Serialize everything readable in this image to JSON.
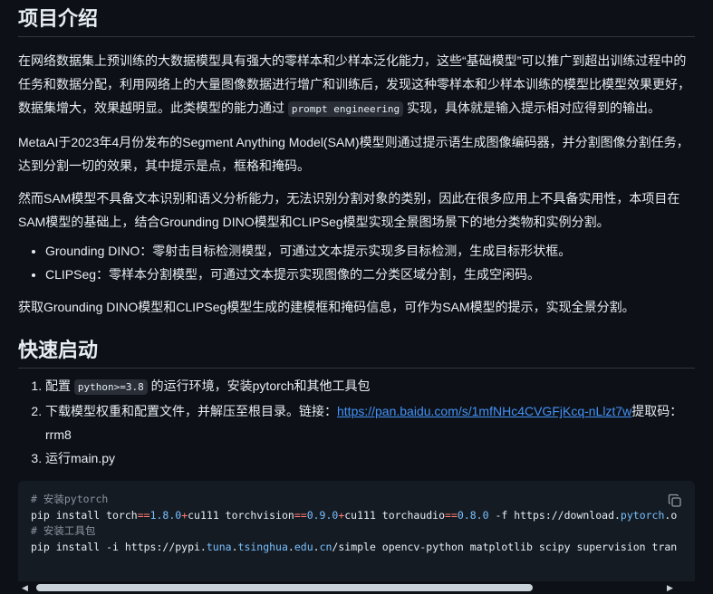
{
  "intro": {
    "heading": "项目介绍",
    "p1_a": "在网络数据集上预训练的大数据模型具有强大的零样本和少样本泛化能力，这些“基础模型”可以推广到超出训练过程中的任务和数据分配，利用网络上的大量图像数据进行增广和训练后，发现这种零样本和少样本训练的模型比模型效果更好，数据集增大，效果越明显。此类模型的能力通过",
    "p1_code": "prompt engineering",
    "p1_b": "实现，具体就是输入提示相对应得到的输出。",
    "p2": "MetaAI于2023年4月份发布的Segment Anything Model(SAM)模型则通过提示语生成图像编码器，并分割图像分割任务，达到分割一切的效果，其中提示是点，框格和掩码。",
    "p3": "然而SAM模型不具备文本识别和语义分析能力，无法识别分割对象的类别，因此在很多应用上不具备实用性，本项目在SAM模型的基础上，结合Grounding DINO模型和CLIPSeg模型实现全景图场景下的地分类物和实例分割。",
    "bullets": [
      "Grounding DINO：零射击目标检测模型，可通过文本提示实现多目标检测，生成目标形状框。",
      "CLIPSeg：零样本分割模型，可通过文本提示实现图像的二分类区域分割，生成空闲码。"
    ],
    "p4": "获取Grounding DINO模型和CLIPSeg模型生成的建模框和掩码信息，可作为SAM模型的提示，实现全景分割。"
  },
  "quick": {
    "heading": "快速启动",
    "step1_a": "配置",
    "step1_code": "python>=3.8",
    "step1_b": "的运行环境，安装pytorch和其他工具包",
    "step2_a": "下载模型权重和配置文件，并解压至根目录。链接：",
    "step2_link": "https://pan.baidu.com/s/1mfNHc4CVGFjKcq-nLlzt7w",
    "step2_b": "提取码：rrm8",
    "step3": "运行main.py"
  },
  "code": {
    "c1": "# 安装pytorch",
    "l2_a": "pip install torch",
    "l2_op1": "==",
    "l2_n1": "1.8.0",
    "l2_op2": "+",
    "l2_b": "cu111 torchvision",
    "l2_op3": "==",
    "l2_n2": "0.9.0",
    "l2_op4": "+",
    "l2_c": "cu111 torchaudio",
    "l2_op5": "==",
    "l2_n3": "0.8.0",
    "l2_d": " -f https://download.",
    "l2_n4": "pytorch",
    "l2_e": ".o",
    "c2": "# 安装工具包",
    "l4_a": "pip install -i https://pypi.",
    "l4_n1": "tuna",
    "l4_b": ".",
    "l4_n2": "tsinghua",
    "l4_c": ".",
    "l4_n3": "edu",
    "l4_d": ".",
    "l4_n4": "cn",
    "l4_e": "/simple opencv-python matplotlib scipy supervision tran"
  },
  "icons": {
    "copy": "copy-icon",
    "left": "scroll-left-icon",
    "right": "scroll-right-icon"
  },
  "colors": {
    "background": "#0d1117",
    "link": "#4493f8",
    "code_bg": "#151b23"
  }
}
